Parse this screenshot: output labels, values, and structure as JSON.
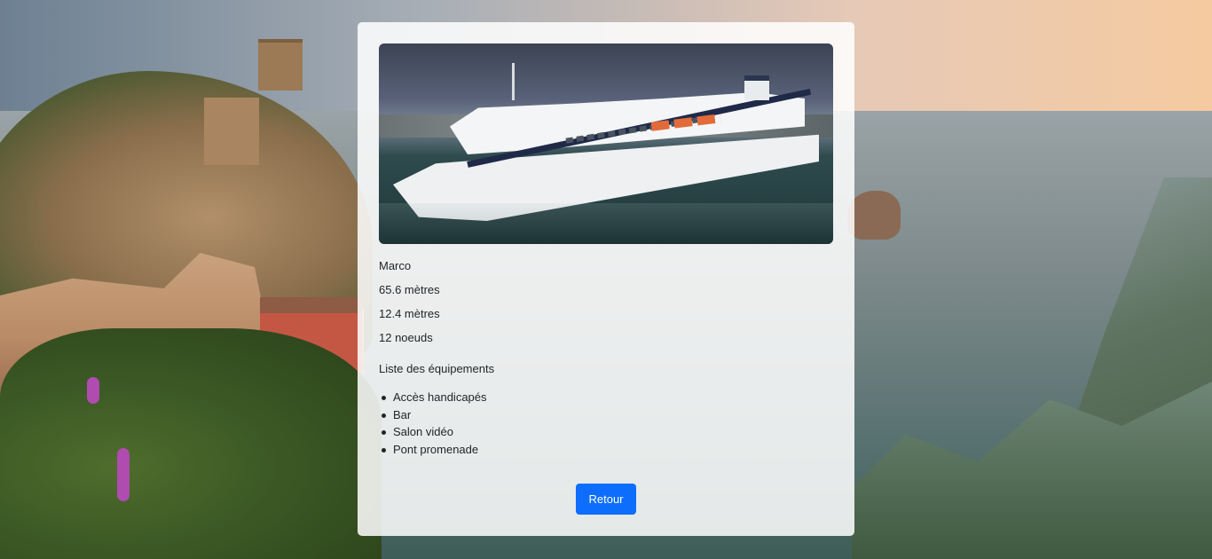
{
  "boat": {
    "name": "Marco",
    "length": "65.6 mètres",
    "width": "12.4 mètres",
    "speed": "12 noeuds"
  },
  "equipment": {
    "title": "Liste des équipements",
    "items": [
      "Accès handicapés",
      "Bar",
      "Salon vidéo",
      "Pont promenade"
    ]
  },
  "actions": {
    "back_label": "Retour"
  },
  "colors": {
    "primary": "#0d6efd",
    "card_bg": "rgba(255,255,255,0.86)"
  }
}
